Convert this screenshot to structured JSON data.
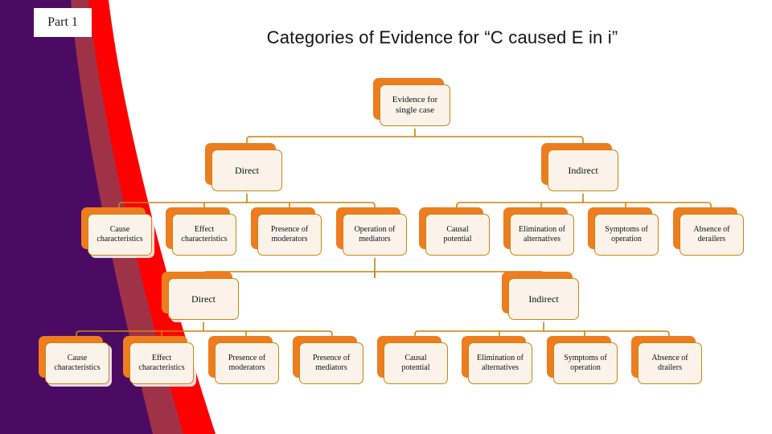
{
  "slide": {
    "part_badge": "Part 1",
    "title": "Categories of  Evidence for “C caused E in i”",
    "colors": {
      "band_purple": "#4B0B63",
      "band_darkred": "#A03248",
      "band_red": "#FF0000",
      "node_shadow": "#ED7D1F",
      "node_face": "#FBF3EA",
      "node_border": "#C8860D",
      "connector": "#C8860D",
      "title_text": "#141414",
      "badge_bg": "#FFFFFF"
    }
  },
  "diagram": {
    "root": {
      "label": "Evidence for\nsingle case"
    },
    "tier1": {
      "direct_label": "Direct",
      "indirect_label": "Indirect",
      "leaves": [
        {
          "label": "Cause\ncharacteristics"
        },
        {
          "label": "Effect\ncharacteristics"
        },
        {
          "label": "Presence of\nmoderators"
        },
        {
          "label": "Operation of\nmediators"
        },
        {
          "label": "Causal\npotential"
        },
        {
          "label": "Elimination of\nalternatives"
        },
        {
          "label": "Symptoms of\noperation"
        },
        {
          "label": "Absence of\nderailers"
        }
      ]
    },
    "tier2": {
      "direct_label": "Direct",
      "indirect_label": "Indirect",
      "leaves": [
        {
          "label": "Cause\ncharacteristics"
        },
        {
          "label": "Effect\ncharacteristics"
        },
        {
          "label": "Presence of\nmoderators"
        },
        {
          "label": "Presence of\nmediators"
        },
        {
          "label": "Causal\npotential"
        },
        {
          "label": "Elimination of\nalternatives"
        },
        {
          "label": "Symptoms of\noperation"
        },
        {
          "label": "Absence of\ndrailers"
        }
      ]
    }
  }
}
